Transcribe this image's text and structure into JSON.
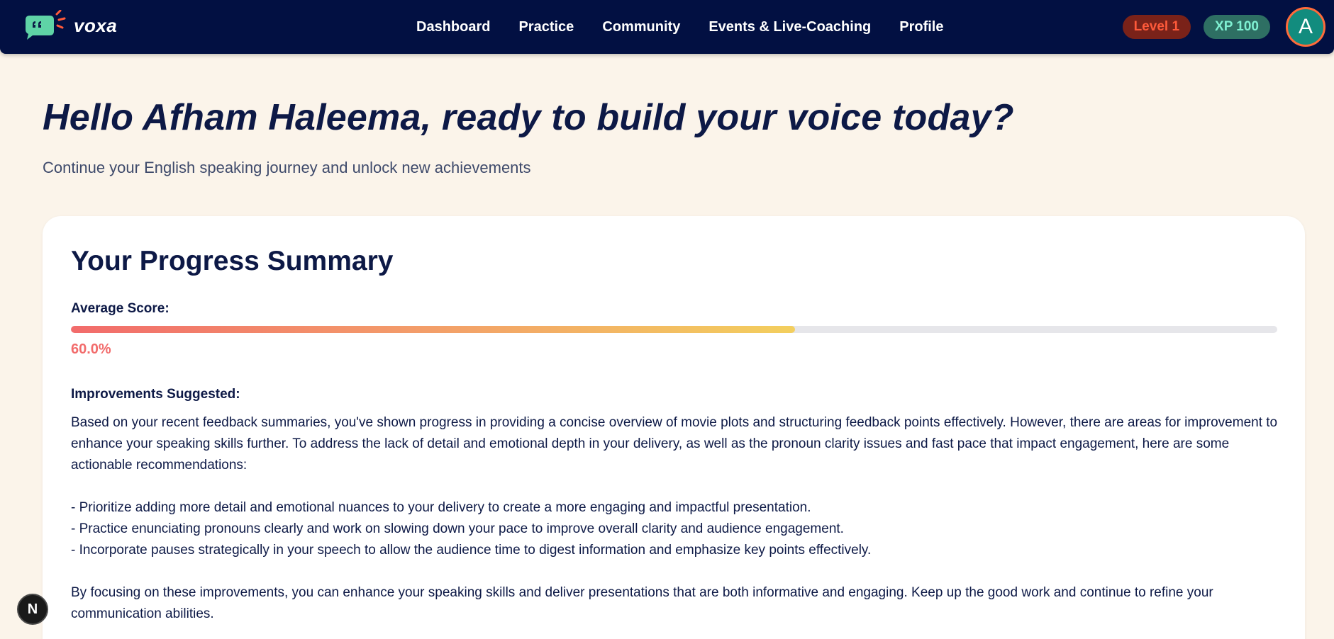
{
  "brand": {
    "name": "voxa",
    "logo_icon": "chat-bubble-quote-icon"
  },
  "nav": {
    "links": [
      "Dashboard",
      "Practice",
      "Community",
      "Events & Live-Coaching",
      "Profile"
    ]
  },
  "status": {
    "level_label": "Level 1",
    "xp_label": "XP 100",
    "avatar_initial": "A"
  },
  "hero": {
    "title": "Hello Afham Haleema, ready to build your voice today?",
    "subtitle": "Continue your English speaking journey and unlock new achievements"
  },
  "summary": {
    "title": "Your Progress Summary",
    "average_label": "Average Score:",
    "average_value": "60.0%",
    "average_fraction": 0.6,
    "improvements_heading": "Improvements Suggested:",
    "intro": "Based on your recent feedback summaries, you've shown progress in providing a concise overview of movie plots and structuring feedback points effectively. However, there are areas for improvement to enhance your speaking skills further. To address the lack of detail and emotional depth in your delivery, as well as the pronoun clarity issues and fast pace that impact engagement, here are some actionable recommendations:",
    "recommendations": [
      "- Prioritize adding more detail and emotional nuances to your delivery to create a more engaging and impactful presentation.",
      "- Practice enunciating pronouns clearly and work on slowing down your pace to improve overall clarity and audience engagement.",
      "- Incorporate pauses strategically in your speech to allow the audience time to digest information and emphasize key points effectively."
    ],
    "conclusion": "By focusing on these improvements, you can enhance your speaking skills and deliver presentations that are both informative and engaging. Keep up the good work and continue to refine your communication abilities."
  },
  "fab": {
    "label": "N"
  },
  "colors": {
    "navbar": "#021042",
    "page_bg": "#fbf4ea",
    "accent_red": "#f26b6b",
    "xp_badge": "#2e6f63",
    "level_badge": "#7a2219"
  }
}
